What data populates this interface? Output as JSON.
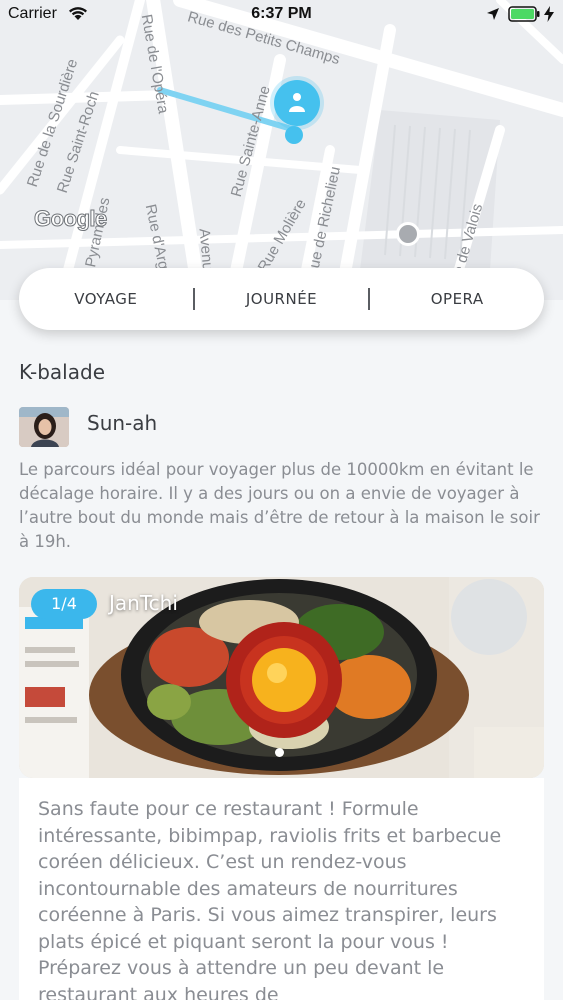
{
  "status_bar": {
    "carrier": "Carrier",
    "time": "6:37 PM",
    "icons": [
      "wifi-icon",
      "location-arrow-icon",
      "battery-icon",
      "bolt-icon"
    ]
  },
  "map": {
    "streets": [
      "Rue des Petits Champs",
      "Rue de l'Opéra",
      "Rue de la Sourdière",
      "Rue Saint-Roch",
      "Rue Sainte-Anne",
      "Rue de Richelieu",
      "Rue Molière",
      "Rue d'Arg",
      "Avenu",
      "s Pyramides",
      "e de Valois"
    ],
    "attribution": "Google",
    "accent_color": "#45c1ee"
  },
  "tabs": [
    {
      "label": "VOYAGE"
    },
    {
      "label": "JOURNÉE"
    },
    {
      "label": "OPERA"
    }
  ],
  "balade": {
    "title": "K-balade",
    "author": "Sun-ah",
    "description": "Le parcours idéal pour voyager plus de 10000km en évitant le décalage horaire. Il y a des jours ou on a envie de voyager à l’autre bout du monde mais d’être de retour à la maison le soir à 19h."
  },
  "photo": {
    "counter": "1/4",
    "title": "JanTchi",
    "counter_color": "#3bb7ec"
  },
  "review": {
    "text": "Sans faute pour ce restaurant ! Formule intéressante, bibimpap, raviolis frits et barbecue coréen délicieux. C’est un rendez-vous incontournable des amateurs de nourritures coréenne à Paris. Si vous aimez transpirer, leurs plats épicé et piquant seront la pour vous ! Préparez vous à attendre un peu devant le restaurant aux heures de"
  }
}
